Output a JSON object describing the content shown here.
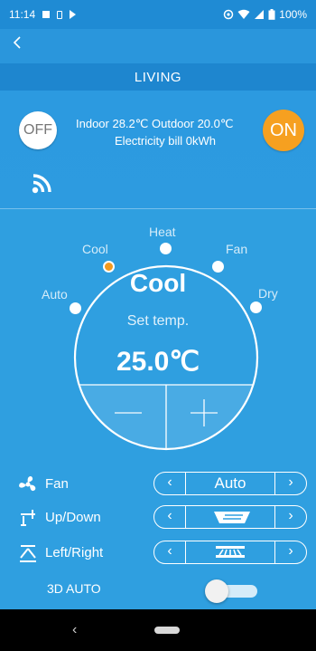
{
  "status_bar": {
    "time": "11:14",
    "battery": "100%"
  },
  "title": "LIVING",
  "info": {
    "off_label": "OFF",
    "on_label": "ON",
    "line1": "Indoor 28.2℃  Outdoor 20.0℃",
    "line2": "Electricity bill 0kWh"
  },
  "modes": {
    "auto": "Auto",
    "cool": "Cool",
    "heat": "Heat",
    "fan": "Fan",
    "dry": "Dry",
    "selected": "Cool"
  },
  "set_temp_label": "Set temp.",
  "set_temp_value": "25.0℃",
  "fan": {
    "label": "Fan",
    "value": "Auto"
  },
  "up_down": {
    "label": "Up/Down"
  },
  "left_right": {
    "label": "Left/Right"
  },
  "auto3d": {
    "label": "3D AUTO",
    "on": false
  },
  "colors": {
    "background": "#2f9fe0",
    "on_button": "#f6a020",
    "selected_mode": "#f39a1f"
  }
}
